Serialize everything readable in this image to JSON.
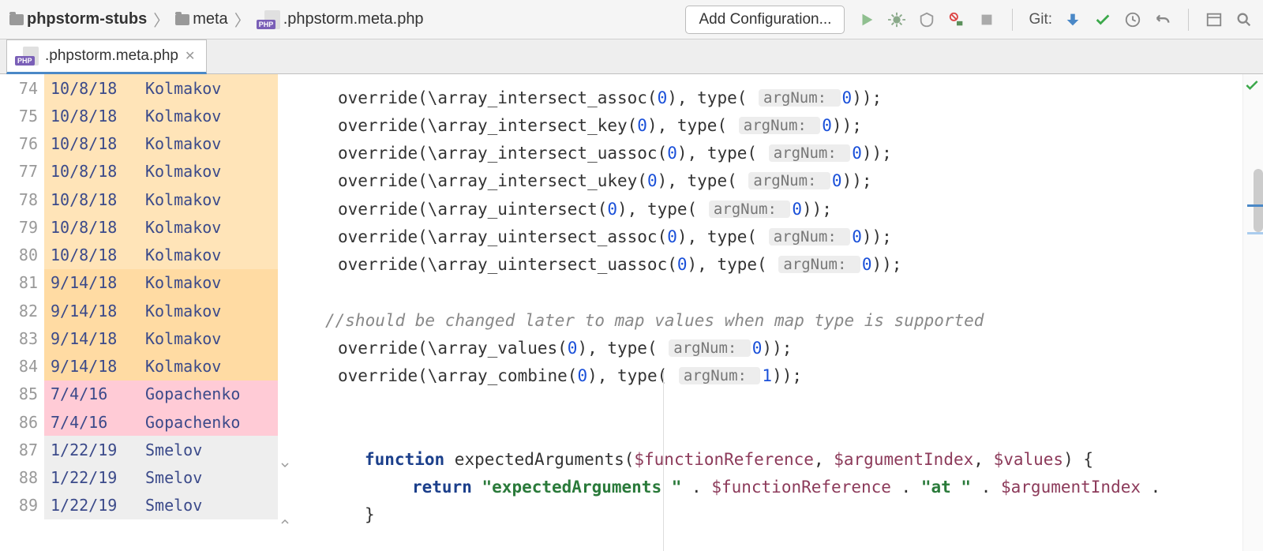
{
  "breadcrumb": {
    "root": "phpstorm-stubs",
    "folder": "meta",
    "file": ".phpstorm.meta.php",
    "php_badge": "PHP"
  },
  "toolbar": {
    "add_config": "Add Configuration...",
    "git_label": "Git:"
  },
  "tab": {
    "label": ".phpstorm.meta.php",
    "php_badge": "PHP"
  },
  "gutter": [
    {
      "line": 74,
      "date": "10/8/18",
      "author": "Kolmakov",
      "bg": "bg-orange"
    },
    {
      "line": 75,
      "date": "10/8/18",
      "author": "Kolmakov",
      "bg": "bg-orange"
    },
    {
      "line": 76,
      "date": "10/8/18",
      "author": "Kolmakov",
      "bg": "bg-orange"
    },
    {
      "line": 77,
      "date": "10/8/18",
      "author": "Kolmakov",
      "bg": "bg-orange"
    },
    {
      "line": 78,
      "date": "10/8/18",
      "author": "Kolmakov",
      "bg": "bg-orange"
    },
    {
      "line": 79,
      "date": "10/8/18",
      "author": "Kolmakov",
      "bg": "bg-orange"
    },
    {
      "line": 80,
      "date": "10/8/18",
      "author": "Kolmakov",
      "bg": "bg-orange"
    },
    {
      "line": 81,
      "date": "9/14/18",
      "author": "Kolmakov",
      "bg": "bg-orange2"
    },
    {
      "line": 82,
      "date": "9/14/18",
      "author": "Kolmakov",
      "bg": "bg-orange2"
    },
    {
      "line": 83,
      "date": "9/14/18",
      "author": "Kolmakov",
      "bg": "bg-orange2"
    },
    {
      "line": 84,
      "date": "9/14/18",
      "author": "Kolmakov",
      "bg": "bg-orange2"
    },
    {
      "line": 85,
      "date": "7/4/16",
      "author": "Gopachenko",
      "bg": "bg-pink"
    },
    {
      "line": 86,
      "date": "7/4/16",
      "author": "Gopachenko",
      "bg": "bg-pink"
    },
    {
      "line": 87,
      "date": "1/22/19",
      "author": "Smelov",
      "bg": "bg-grey"
    },
    {
      "line": 88,
      "date": "1/22/19",
      "author": "Smelov",
      "bg": "bg-grey"
    },
    {
      "line": 89,
      "date": "1/22/19",
      "author": "Smelov",
      "bg": "bg-grey"
    }
  ],
  "code": {
    "override_lines": [
      {
        "fn": "\\array_intersect_assoc",
        "argNum": "0"
      },
      {
        "fn": "\\array_intersect_key",
        "argNum": "0"
      },
      {
        "fn": "\\array_intersect_uassoc",
        "argNum": "0"
      },
      {
        "fn": "\\array_intersect_ukey",
        "argNum": "0"
      },
      {
        "fn": "\\array_uintersect",
        "argNum": "0"
      },
      {
        "fn": "\\array_uintersect_assoc",
        "argNum": "0"
      },
      {
        "fn": "\\array_uintersect_uassoc",
        "argNum": "0"
      }
    ],
    "comment": "//should be changed later to map values when map type is supported",
    "override_lines2": [
      {
        "fn": "\\array_values",
        "argNum": "0"
      },
      {
        "fn": "\\array_combine",
        "argNum": "1"
      }
    ],
    "fn_kw": "function",
    "fn_name": "expectedArguments",
    "fn_params": [
      "$functionReference",
      "$argumentIndex",
      "$values"
    ],
    "return_kw": "return",
    "str1": "\"expectedArguments \"",
    "str2": "\"at \"",
    "close_brace": "}",
    "hint_label": "argNum:",
    "override_word": "override",
    "type_word": "type",
    "zero": "0"
  }
}
